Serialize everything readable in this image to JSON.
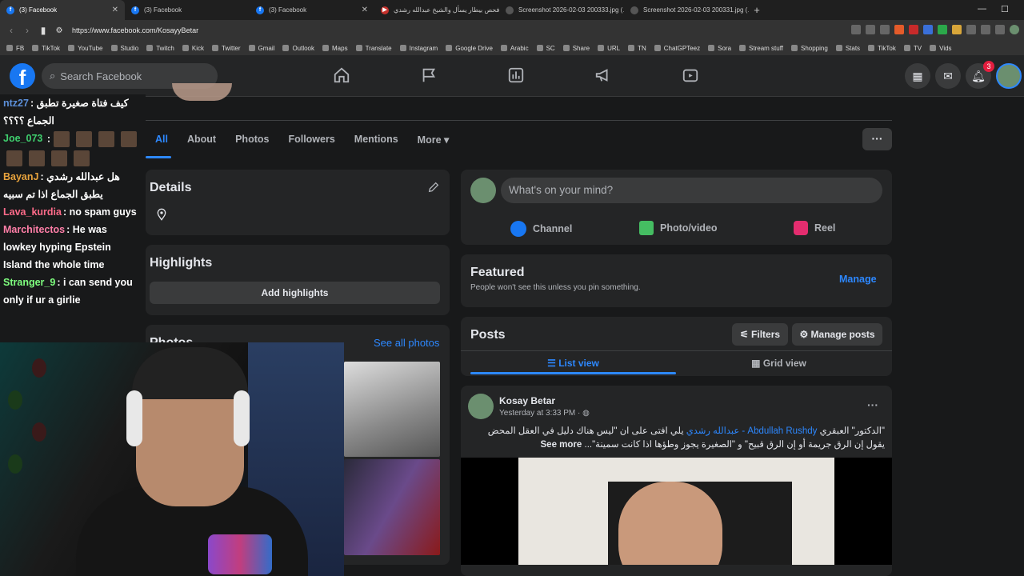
{
  "browser": {
    "tabs": [
      {
        "title": "(3) Facebook",
        "active": true
      },
      {
        "title": "(3) Facebook"
      },
      {
        "title": "(3) Facebook"
      },
      {
        "title": "فحص بيطار يسأل والشيخ عبدالله رشدي"
      },
      {
        "title": "Screenshot 2026-02-03 200333.jpg (…"
      },
      {
        "title": "Screenshot 2026-02-03 200331.jpg (…"
      }
    ],
    "new_tab": "+",
    "url": "https://www.facebook.com/KosayyBetar",
    "bookmarks": [
      "FB",
      "TikTok",
      "YouTube",
      "Studio",
      "Twitch",
      "Kick",
      "Twitter",
      "Gmail",
      "Outlook",
      "Maps",
      "Translate",
      "Instagram",
      "Google Drive",
      "Arabic",
      "SC",
      "Share",
      "URL",
      "TN",
      "ChatGPTeez",
      "Sora",
      "Stream stuff",
      "Shopping",
      "Stats",
      "TikTok",
      "TV",
      "Vids"
    ]
  },
  "fbnav": {
    "logo": "f",
    "search_placeholder": "Search Facebook",
    "notif_count": "3"
  },
  "profile": {
    "tabs": [
      "All",
      "About",
      "Photos",
      "Followers",
      "Mentions",
      "More ▾"
    ],
    "more_btn": "···"
  },
  "details": {
    "title": "Details",
    "highlights_title": "Highlights",
    "add_highlights": "Add highlights",
    "photos_title": "Photos",
    "see_all_photos": "See all photos"
  },
  "composer": {
    "placeholder": "What's on your mind?",
    "actions": [
      "Channel",
      "Photo/video",
      "Reel"
    ]
  },
  "featured": {
    "title": "Featured",
    "subtitle": "People won't see this unless you pin something.",
    "manage": "Manage"
  },
  "posts": {
    "title": "Posts",
    "filters": "Filters",
    "manage_posts": "Manage posts",
    "list_view": "List view",
    "grid_view": "Grid view"
  },
  "post": {
    "author": "Kosay Betar",
    "time": "Yesterday at 3:33 PM",
    "line1_prefix": "\"الدكتور\" العبقري",
    "mention": "Abdullah Rushdy - عبدالله رشدي",
    "line1_suffix": "يلي افتى على ان \"ليس هناك دليل في العقل المحض",
    "line2": "يقول إن الرق جريمة أو إن الرق قبيح\" و \"الصغيرة يجوز وطؤها اذا كانت سمينة\"...",
    "see_more": "See more",
    "menu": "···"
  },
  "chat": [
    {
      "user": "ntz27",
      "color": "#5b8fd9",
      "text": ": كيف فتاة صغيرة تطبق الجماع ؟؟؟؟",
      "rtl": true
    },
    {
      "user": "Joe_073",
      "color": "#3fcf6e",
      "text": " :",
      "emojis": 8
    },
    {
      "user": "BayanJ",
      "color": "#e8a33d",
      "text": ": هل عبدالله رشدي يطبق الجماع اذا تم سبيه",
      "rtl": true
    },
    {
      "user": "Lava_kurdia",
      "color": "#ff6b8a",
      "text": ": no spam guys"
    },
    {
      "user": "Marchitectos",
      "color": "#ff7fa8",
      "text": ": He was lowkey hyping Epstein Island the whole time"
    },
    {
      "user": "Stranger_9",
      "color": "#7fff7f",
      "text": ": i can send you only if ur a girlie"
    }
  ],
  "colors": {
    "fb_blue": "#1877f2",
    "link": "#2d88ff",
    "bg": "#18191a",
    "card": "#242526"
  }
}
